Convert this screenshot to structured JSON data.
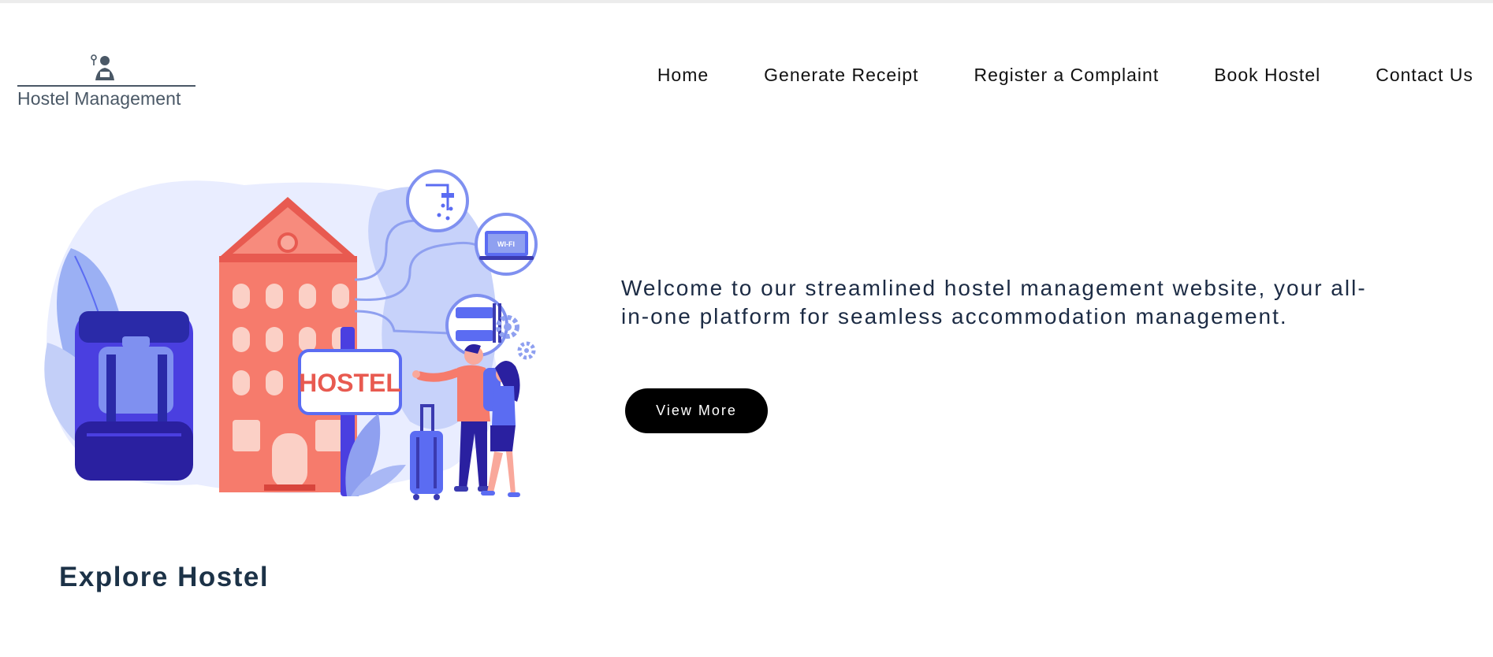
{
  "header": {
    "logo_text": "Hostel Management",
    "nav": [
      {
        "label": "Home"
      },
      {
        "label": "Generate Receipt"
      },
      {
        "label": "Register a Complaint"
      },
      {
        "label": "Book Hostel"
      },
      {
        "label": "Contact Us"
      }
    ]
  },
  "hero": {
    "illustration": {
      "sign_text": "HOSTEL",
      "laptop_text": "WI-FI",
      "icons": [
        "hostel-building-icon",
        "shower-icon",
        "wifi-laptop-icon",
        "bunk-bed-icon",
        "backpack-icon",
        "suitcase-icon",
        "gear-icon",
        "travelers-icon"
      ]
    },
    "welcome_text": "Welcome to our streamlined hostel management website, your all-in-one platform for seamless accommodation management.",
    "button_label": "View More"
  },
  "explore": {
    "title": "Explore Hostel"
  },
  "colors": {
    "primary_text": "#1c2b44",
    "button_bg": "#000000",
    "illustration_blue": "#5b6cf2",
    "illustration_coral": "#f47c6d"
  }
}
